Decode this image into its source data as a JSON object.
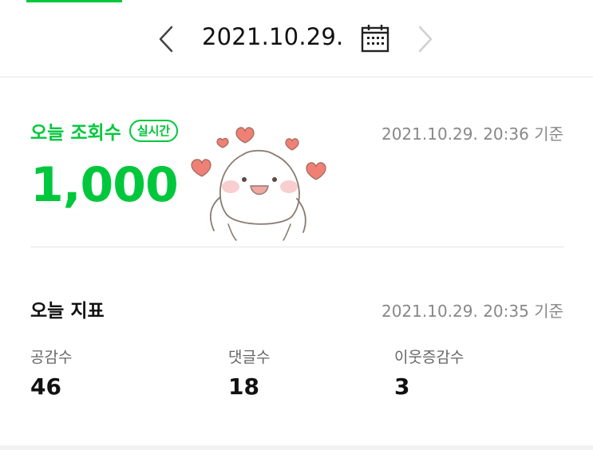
{
  "date_nav": {
    "date": "2021.10.29.",
    "icons": {
      "prev": "chevron-left-icon",
      "next": "chevron-right-icon",
      "calendar": "calendar-icon"
    }
  },
  "views": {
    "title": "오늘 조회수",
    "badge": "실시간",
    "count": "1,000",
    "timestamp": "2021.10.29. 20:36 기준"
  },
  "metrics": {
    "title": "오늘 지표",
    "timestamp": "2021.10.29. 20:35 기준",
    "items": [
      {
        "label": "공감수",
        "value": "46"
      },
      {
        "label": "댓글수",
        "value": "18"
      },
      {
        "label": "이웃증감수",
        "value": "3"
      }
    ]
  },
  "colors": {
    "accent": "#00c73c",
    "muted_text": "#888888",
    "divider": "#e6e6e6",
    "heart": "#f08080"
  }
}
